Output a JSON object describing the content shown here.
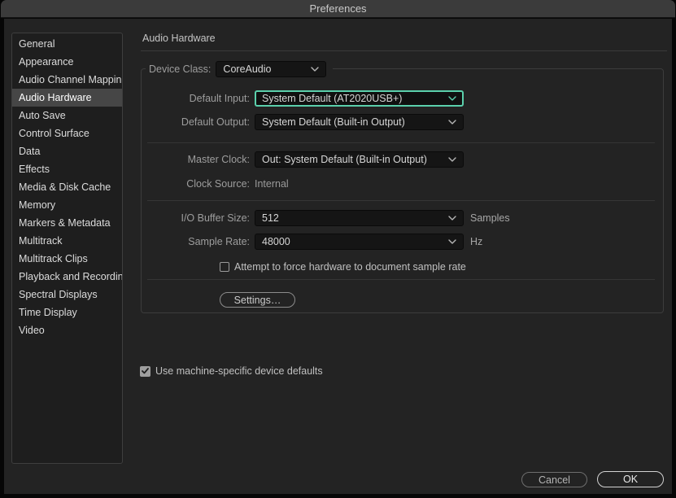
{
  "window": {
    "title": "Preferences"
  },
  "sidebar": {
    "items": [
      "General",
      "Appearance",
      "Audio Channel Mapping",
      "Audio Hardware",
      "Auto Save",
      "Control Surface",
      "Data",
      "Effects",
      "Media & Disk Cache",
      "Memory",
      "Markers & Metadata",
      "Multitrack",
      "Multitrack Clips",
      "Playback and Recording",
      "Spectral Displays",
      "Time Display",
      "Video"
    ],
    "selected": "Audio Hardware"
  },
  "panel": {
    "title": "Audio Hardware",
    "device_class": {
      "label": "Device Class:",
      "value": "CoreAudio"
    },
    "default_input": {
      "label": "Default Input:",
      "value": "System Default (AT2020USB+)",
      "focused": true
    },
    "default_output": {
      "label": "Default Output:",
      "value": "System Default (Built-in Output)"
    },
    "master_clock": {
      "label": "Master Clock:",
      "value": "Out: System Default (Built-in Output)"
    },
    "clock_source": {
      "label": "Clock Source:",
      "value": "Internal"
    },
    "io_buffer": {
      "label": "I/O Buffer Size:",
      "value": "512",
      "unit": "Samples"
    },
    "sample_rate": {
      "label": "Sample Rate:",
      "value": "48000",
      "unit": "Hz"
    },
    "force_sample_rate_checkbox": {
      "label": "Attempt to force hardware to document sample rate",
      "checked": false
    },
    "settings_button": "Settings…",
    "machine_defaults_checkbox": {
      "label": "Use machine-specific device defaults",
      "checked": true
    }
  },
  "footer": {
    "cancel": "Cancel",
    "ok": "OK"
  },
  "colors": {
    "focus_accent": "#5bd0ac",
    "selection_bg": "#464646"
  }
}
